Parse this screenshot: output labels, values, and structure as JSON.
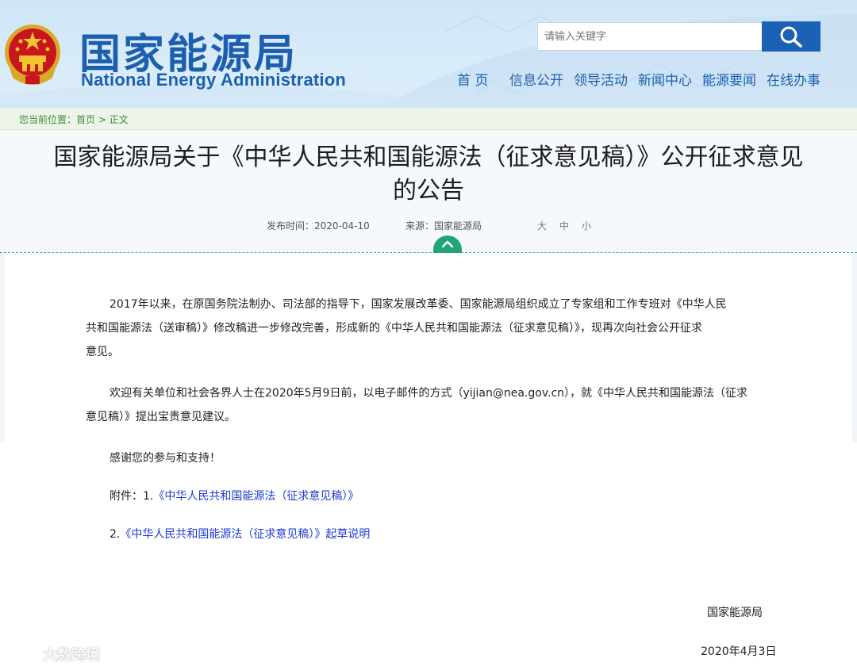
{
  "header": {
    "title_cn": "国家能源局",
    "title_en": "National Energy Administration",
    "search_placeholder": "请输入关键字",
    "nav": [
      "首 页",
      "信息公开",
      "领导活动",
      "新闻中心",
      "能源要闻",
      "在线办事"
    ]
  },
  "breadcrumb": {
    "prefix": "您当前位置：",
    "home": "首页",
    "sep": " > ",
    "current": "正文"
  },
  "article": {
    "title_line1": "国家能源局关于《中华人民共和国能源法（征求意见稿）》公开征求意见",
    "title_line2": "的公告",
    "publish_label": "发布时间：",
    "publish_date": "2020-04-10",
    "source_label": "来源：",
    "source": "国家能源局",
    "font_sizes": [
      "大",
      "中",
      "小"
    ],
    "p1_line1": "2017年以来，在原国务院法制办、司法部的指导下，国家发展改革委、国家能源局组织成立了专家组和工作专班对《中华人民",
    "p1_line2": "共和国能源法（送审稿）》修改稿进一步修改完善，形成新的《中华人民共和国能源法（征求意见稿）》，现再次向社会公开征求",
    "p1_line3": "意见。",
    "p2_line1": "欢迎有关单位和社会各界人士在2020年5月9日前，以电子邮件的方式（yijian@nea.gov.cn），就《中华人民共和国能源法（征求",
    "p2_line2": "意见稿）》提出宝贵意见建议。",
    "thanks": "感谢您的参与和支持！",
    "attachment_label": "附件：1.",
    "attachment1": "《中华人民共和国能源法（征求意见稿）》",
    "attachment2_prefix": "2.",
    "attachment2": "《中华人民共和国能源法（征求意见稿）》起草说明",
    "signature": "国家能源局",
    "sign_date": "2020年4月3日"
  },
  "watermark": "大数跨境",
  "colors": {
    "brand_blue": "#1d5fae",
    "breadcrumb_green": "#3f8a34",
    "divider_teal": "#22a37a",
    "link_blue": "#1d3bd1"
  },
  "icons": {
    "search": "search-icon",
    "toggle": "chevron-up-icon",
    "emblem": "national-emblem",
    "watermark": "watermark-logo"
  }
}
